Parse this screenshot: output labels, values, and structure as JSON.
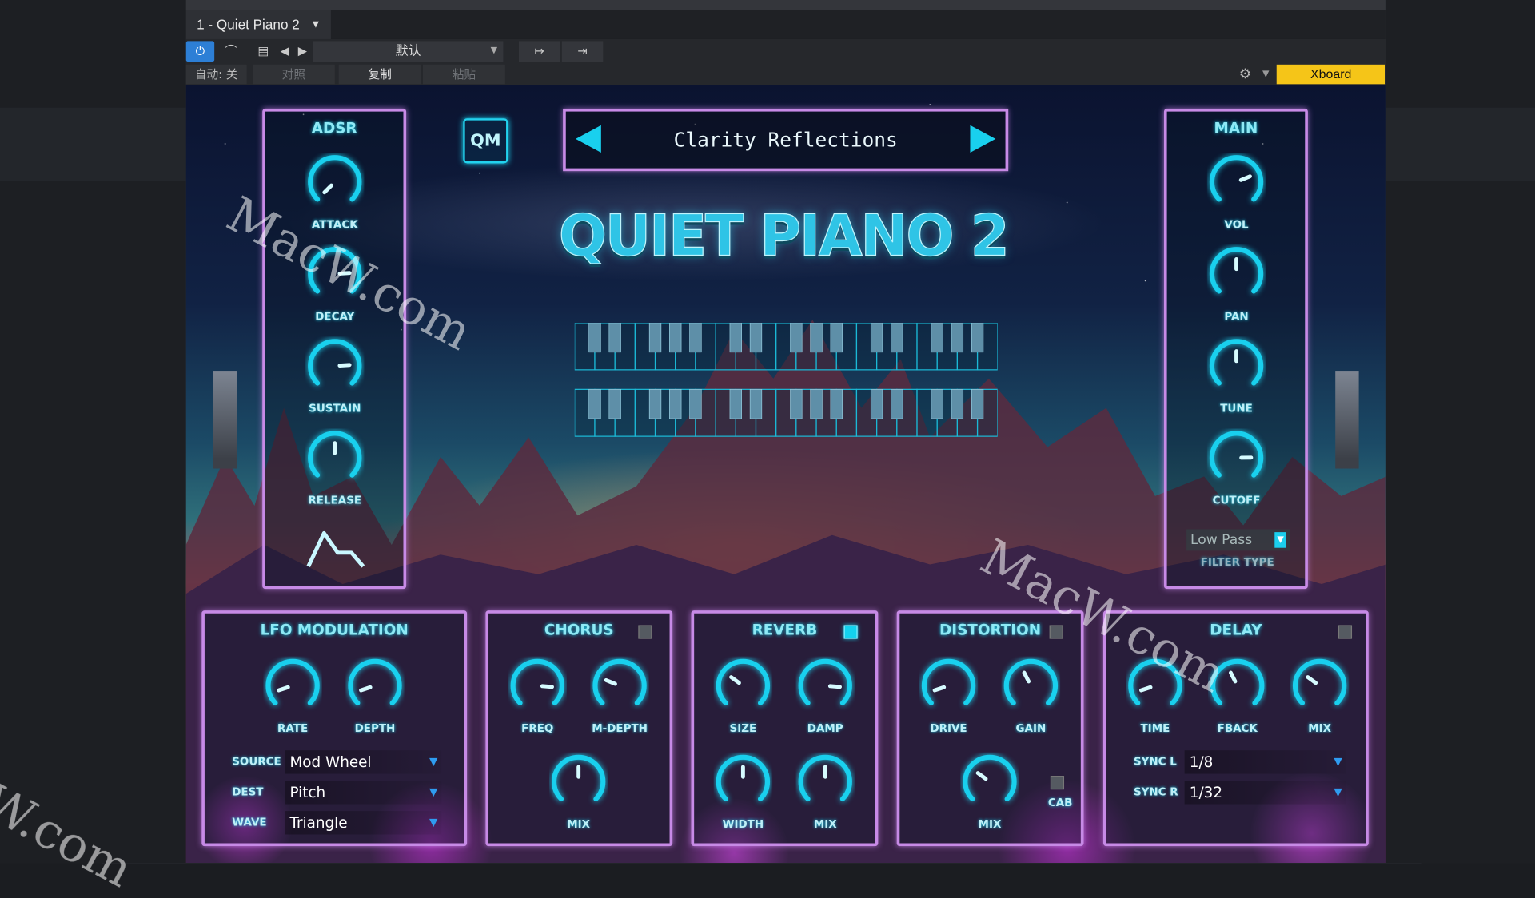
{
  "window": {
    "tab_title": "1 - Quiet Piano 2",
    "preset_select": "默认",
    "auto_label": "自动: 关",
    "compare_label": "对照",
    "copy_label": "复制",
    "paste_label": "粘贴",
    "device_label": "Xboard"
  },
  "plugin": {
    "title": "QUIET PIANO 2",
    "logo": "QM",
    "preset_name": "Clarity Reflections",
    "adsr": {
      "title": "ADSR",
      "knobs": [
        {
          "label": "ATTACK",
          "value": 0.0
        },
        {
          "label": "DECAY",
          "value": 0.82
        },
        {
          "label": "SUSTAIN",
          "value": 0.82
        },
        {
          "label": "RELEASE",
          "value": 0.5
        }
      ]
    },
    "main": {
      "title": "MAIN",
      "knobs": [
        {
          "label": "VOL",
          "value": 0.75
        },
        {
          "label": "PAN",
          "value": 0.5
        },
        {
          "label": "TUNE",
          "value": 0.5
        },
        {
          "label": "CUTOFF",
          "value": 0.83
        }
      ],
      "filter_type": "Low Pass",
      "filter_type_label": "FILTER TYPE"
    },
    "lfo": {
      "title": "LFO MODULATION",
      "knobs": [
        {
          "label": "RATE",
          "value": 0.1
        },
        {
          "label": "DEPTH",
          "value": 0.1
        }
      ],
      "rows": [
        {
          "label": "SOURCE",
          "value": "Mod Wheel"
        },
        {
          "label": "DEST",
          "value": "Pitch"
        },
        {
          "label": "WAVE",
          "value": "Triangle"
        }
      ]
    },
    "chorus": {
      "title": "CHORUS",
      "enabled": false,
      "knobs": [
        {
          "label": "FREQ",
          "value": 0.85
        },
        {
          "label": "M-DEPTH",
          "value": 0.25
        },
        {
          "label": "MIX",
          "value": 0.5
        }
      ]
    },
    "reverb": {
      "title": "REVERB",
      "enabled": true,
      "knobs": [
        {
          "label": "SIZE",
          "value": 0.3
        },
        {
          "label": "DAMP",
          "value": 0.85
        },
        {
          "label": "WIDTH",
          "value": 0.5
        },
        {
          "label": "MIX",
          "value": 0.5
        }
      ]
    },
    "distortion": {
      "title": "DISTORTION",
      "enabled": false,
      "knobs": [
        {
          "label": "DRIVE",
          "value": 0.1
        },
        {
          "label": "GAIN",
          "value": 0.4
        },
        {
          "label": "MIX",
          "value": 0.3
        }
      ],
      "cab_label": "CAB"
    },
    "delay": {
      "title": "DELAY",
      "enabled": false,
      "knobs": [
        {
          "label": "TIME",
          "value": 0.1
        },
        {
          "label": "FBACK",
          "value": 0.4
        },
        {
          "label": "MIX",
          "value": 0.3
        }
      ],
      "rows": [
        {
          "label": "SYNC L",
          "value": "1/8"
        },
        {
          "label": "SYNC R",
          "value": "1/32"
        }
      ]
    }
  },
  "watermarks": [
    "MacW.com",
    "MacW.com",
    "W.com"
  ],
  "colors": {
    "accent": "#19d0ee",
    "panel_border": "#c78ae6",
    "device_badge": "#f5c518",
    "power": "#2d7fd6"
  }
}
